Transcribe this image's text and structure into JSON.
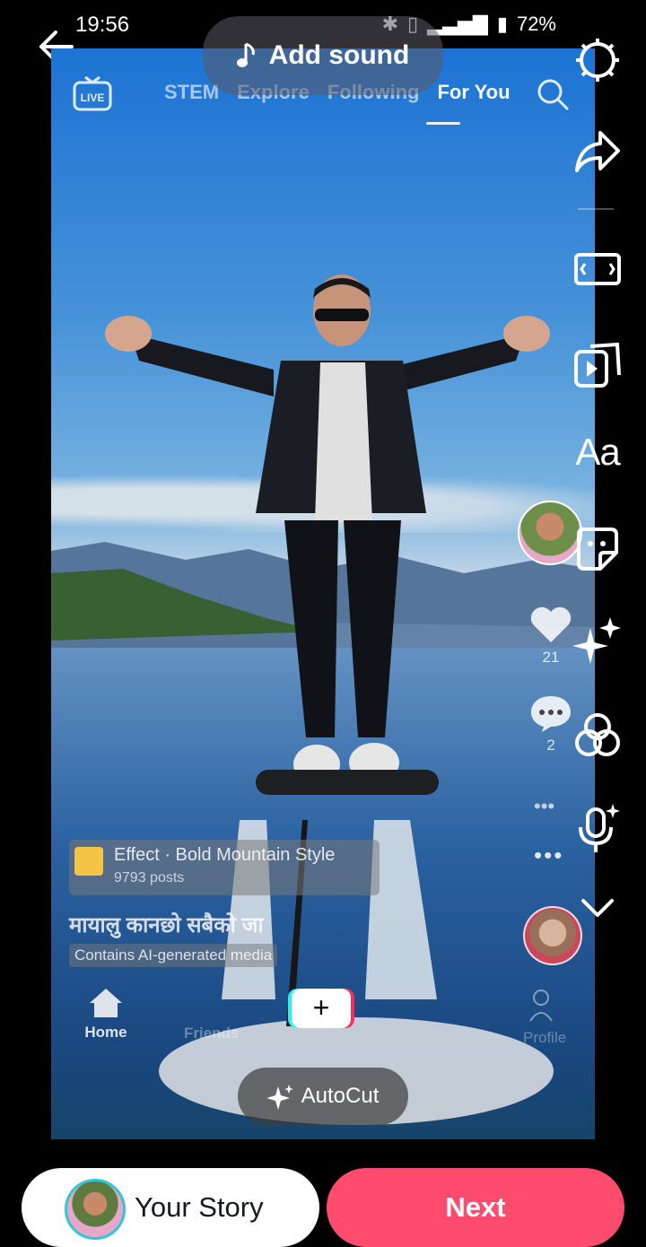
{
  "status_bar": {
    "time": "19:56",
    "battery": "72%"
  },
  "header": {
    "add_sound_label": "Add sound"
  },
  "preview": {
    "tabs": [
      "STEM",
      "Explore",
      "Following",
      "For You"
    ],
    "like_count": "21",
    "comment_count": "2",
    "effect_title": "Effect · Bold Mountain Style",
    "effect_sub": "9793 posts",
    "caption": "मायालु कानछो सबैको जा",
    "ai_label": "Contains AI-generated media",
    "nav": {
      "home": "Home",
      "friends": "Friends",
      "profile": "Profile"
    },
    "autocut_label": "AutoCut"
  },
  "tools": {
    "text_tool_label": "Aa"
  },
  "footer": {
    "story_label": "Your Story",
    "next_label": "Next"
  },
  "colors": {
    "next_button": "#fe4b6e",
    "story_ring": "#31c7d6"
  }
}
